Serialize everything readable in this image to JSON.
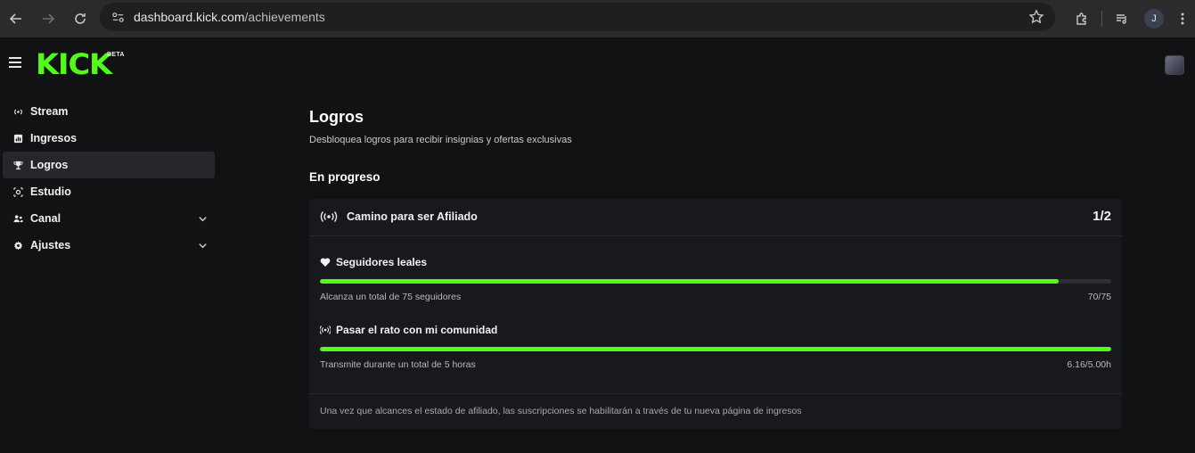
{
  "browser": {
    "url_host": "dashboard.kick.com",
    "url_path": "/achievements",
    "profile_initial": "J"
  },
  "header": {
    "logo_text": "KICK",
    "logo_badge": "BETA"
  },
  "sidebar": {
    "items": [
      {
        "label": "Stream",
        "icon": "broadcast-icon"
      },
      {
        "label": "Ingresos",
        "icon": "dollar-square-icon"
      },
      {
        "label": "Logros",
        "icon": "trophy-icon",
        "active": true
      },
      {
        "label": "Estudio",
        "icon": "camera-icon"
      },
      {
        "label": "Canal",
        "icon": "users-icon",
        "expandable": true
      },
      {
        "label": "Ajustes",
        "icon": "gear-icon",
        "expandable": true
      }
    ]
  },
  "main": {
    "title": "Logros",
    "subtitle": "Desbloquea logros para recibir insignias y ofertas exclusivas",
    "section_title": "En progreso",
    "card": {
      "title": "Camino para ser Afiliado",
      "count": "1/2",
      "tasks": [
        {
          "icon": "heart-icon",
          "title": "Seguidores leales",
          "description": "Alcanza un total de 75 seguidores",
          "value_text": "70/75",
          "progress": 0.933
        },
        {
          "icon": "broadcast-icon",
          "title": "Pasar el rato con mi comunidad",
          "description": "Transmite durante un total de 5 horas",
          "value_text": "6.16/5.00h",
          "progress": 1.0
        }
      ],
      "footer": "Una vez que alcances el estado de afiliado, las suscripciones se habilitarán a través de tu nueva página de ingresos"
    }
  },
  "colors": {
    "accent": "#53fc18",
    "background": "#111214",
    "card": "#18191c"
  }
}
